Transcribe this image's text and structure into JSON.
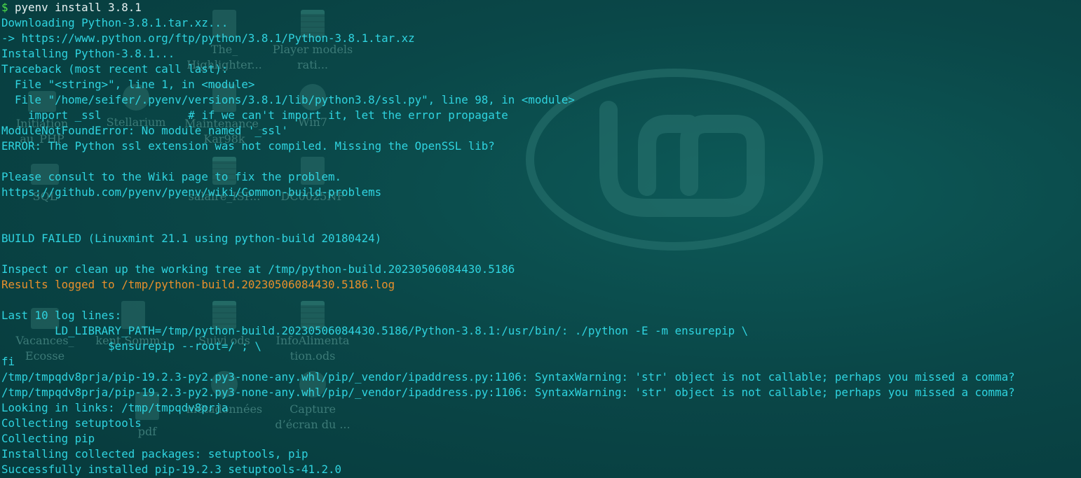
{
  "prompt": {
    "symbol": "$",
    "command": "pyenv install 3.8.1"
  },
  "output": [
    {
      "text": "Downloading Python-3.8.1.tar.xz..."
    },
    {
      "text": "-> https://www.python.org/ftp/python/3.8.1/Python-3.8.1.tar.xz"
    },
    {
      "text": "Installing Python-3.8.1..."
    },
    {
      "text": "Traceback (most recent call last):"
    },
    {
      "text": "  File \"<string>\", line 1, in <module>"
    },
    {
      "text": "  File \"/home/seifer/.pyenv/versions/3.8.1/lib/python3.8/ssl.py\", line 98, in <module>"
    },
    {
      "text": "    import _ssl             # if we can't import it, let the error propagate"
    },
    {
      "text": "ModuleNotFoundError: No module named '_ssl'"
    },
    {
      "text": "ERROR: The Python ssl extension was not compiled. Missing the OpenSSL lib?"
    },
    {
      "text": ""
    },
    {
      "text": "Please consult to the Wiki page to fix the problem."
    },
    {
      "text": "https://github.com/pyenv/pyenv/wiki/Common-build-problems"
    },
    {
      "text": ""
    },
    {
      "text": ""
    },
    {
      "text": "BUILD FAILED (Linuxmint 21.1 using python-build 20180424)"
    },
    {
      "text": ""
    },
    {
      "text": "Inspect or clean up the working tree at /tmp/python-build.20230506084430.5186"
    },
    {
      "text": "Results logged to /tmp/python-build.20230506084430.5186.log",
      "color": "orange"
    },
    {
      "text": ""
    },
    {
      "text": "Last 10 log lines:"
    },
    {
      "text": "        LD_LIBRARY_PATH=/tmp/python-build.20230506084430.5186/Python-3.8.1:/usr/bin/: ./python -E -m ensurepip \\"
    },
    {
      "text": "                $ensurepip --root=/ ; \\"
    },
    {
      "text": "fi"
    },
    {
      "text": "/tmp/tmpqdv8prja/pip-19.2.3-py2.py3-none-any.whl/pip/_vendor/ipaddress.py:1106: SyntaxWarning: 'str' object is not callable; perhaps you missed a comma?"
    },
    {
      "text": "/tmp/tmpqdv8prja/pip-19.2.3-py2.py3-none-any.whl/pip/_vendor/ipaddress.py:1106: SyntaxWarning: 'str' object is not callable; perhaps you missed a comma?"
    },
    {
      "text": "Looking in links: /tmp/tmpqdv8prja"
    },
    {
      "text": "Collecting setuptools"
    },
    {
      "text": "Collecting pip"
    },
    {
      "text": "Installing collected packages: setuptools, pip"
    },
    {
      "text": "Successfully installed pip-19.2.3 setuptools-41.2.0"
    }
  ],
  "desktop_icons": [
    {
      "label": "The_ Highlighter...",
      "icon": "document-icon"
    },
    {
      "label": "Player models rati...",
      "icon": "spreadsheet-icon"
    },
    {
      "label": "Stellarium",
      "icon": "application-icon"
    },
    {
      "label": "Maintenance_ Kar98k",
      "icon": "document-icon"
    },
    {
      "label": "Win7",
      "icon": "application-icon"
    },
    {
      "label": "Initiation au_PHP",
      "icon": "folder-icon"
    },
    {
      "label": "SQL",
      "icon": "folder-icon"
    },
    {
      "label": "salaire_ISP...",
      "icon": "spreadsheet-icon"
    },
    {
      "label": "DC0025NF",
      "icon": "document-icon"
    },
    {
      "label": "Vacances_ Ecosse",
      "icon": "folder-icon"
    },
    {
      "label": "kent Somm...",
      "icon": "document-icon"
    },
    {
      "label": "Suivi ods",
      "icon": "spreadsheet-icon"
    },
    {
      "label": "InfoAlimenta tion.ods",
      "icon": "spreadsheet-icon"
    },
    {
      "label": "pdf",
      "icon": "document-icon"
    },
    {
      "label": "métadonnées",
      "icon": "application-icon"
    },
    {
      "label": "Capture d’écran du ...",
      "icon": "application-icon"
    }
  ],
  "colors": {
    "background": "#0a4748",
    "text": "#2fd4e0",
    "prompt": "#4ee24a",
    "command": "#e8f2f2",
    "highlight": "#e8902c"
  }
}
